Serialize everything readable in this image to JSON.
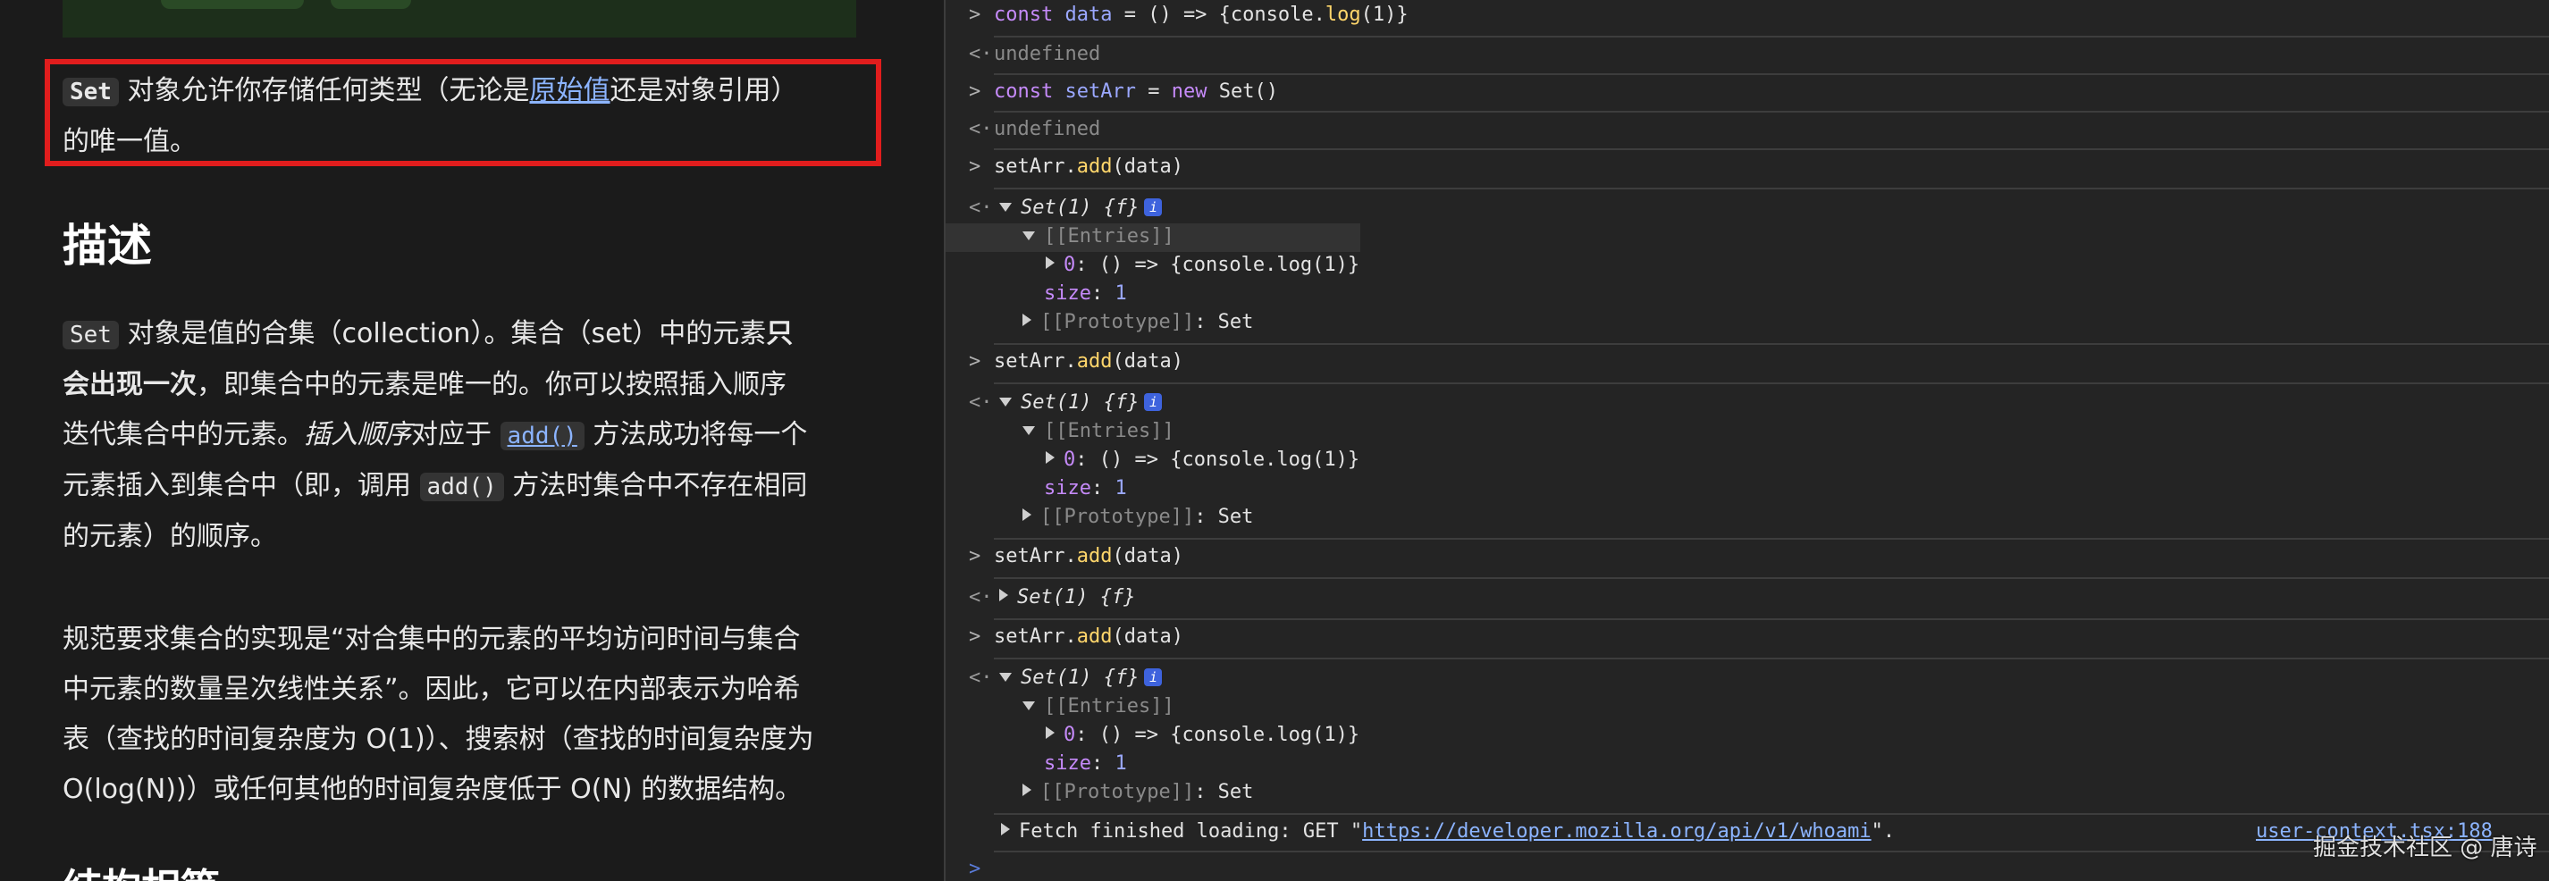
{
  "doc": {
    "intro": {
      "code": "Set",
      "text1": " 对象允许你存储任何类型（无论是",
      "link": "原始值",
      "text2": "还是对象引用）",
      "line2": "的唯一值。"
    },
    "heading": "描述",
    "desc": {
      "code1": "Set",
      "l1a": " 对象是值的合集（collection）。集合（set）中的元素",
      "l1b": "只",
      "l2a": "会出现一次",
      "l2b": "，即集合中的元素是唯一的。你可以按照插入顺序",
      "l3a": "迭代集合中的元素。",
      "l3b": "插入顺序",
      "l3c": "对应于 ",
      "l3link": "add()",
      "l3d": " 方法成功将每一个",
      "l4a": "元素插入到集合中（即，调用 ",
      "l4code": "add()",
      "l4b": " 方法时集合中不存在相同",
      "l5": "的元素）的顺序。"
    },
    "spec": {
      "l1": "规范要求集合的实现是“对合集中的元素的平均访问时间与集合",
      "l2": "中元素的数量呈次线性关系”。因此，它可以在内部表示为哈希",
      "l3": "表（查找的时间复杂度为 O(1)）、搜索树（查找的时间复杂度为",
      "l4": "O(log(N))）或任何其他的时间复杂度低于 O(N) 的数据结构。"
    },
    "next_heading_partial": "结构相等"
  },
  "console": {
    "prompt": ">",
    "ret": "<·",
    "cmd1": {
      "kw": "const",
      "name": "data",
      "rest1": " = () => {console.",
      "fn": "log",
      "rest2": "(1)}"
    },
    "undefined": "undefined",
    "cmd2": {
      "kw": "const",
      "name": "setArr",
      "rest1": " = ",
      "kw2": "new",
      "rest2": " Set()"
    },
    "call": {
      "obj": "setArr.",
      "fn": "add",
      "arg": "(data)"
    },
    "set_summary": "Set(1) {f}",
    "info": "i",
    "entries": "[[Entries]]",
    "entry0_key": "0",
    "entry0_val": ": () => {console.log(1)}",
    "size_key": "size",
    "size_val": "1",
    "proto": "[[Prototype]]",
    "proto_val": ": Set",
    "fetch": {
      "prefix": "Fetch finished loading: GET \"",
      "url": "https://developer.mozilla.org/api/v1/whoami",
      "suffix": "\"."
    },
    "source_link": "user-context.tsx:188"
  },
  "watermark": "掘金技术社区 @ 唐诗",
  "colors": {
    "highlight_box": "#e11d1d",
    "link": "#8cb4ff",
    "keyword": "#c58af9",
    "function": "#ffd66b",
    "number": "#9ba8ff"
  }
}
